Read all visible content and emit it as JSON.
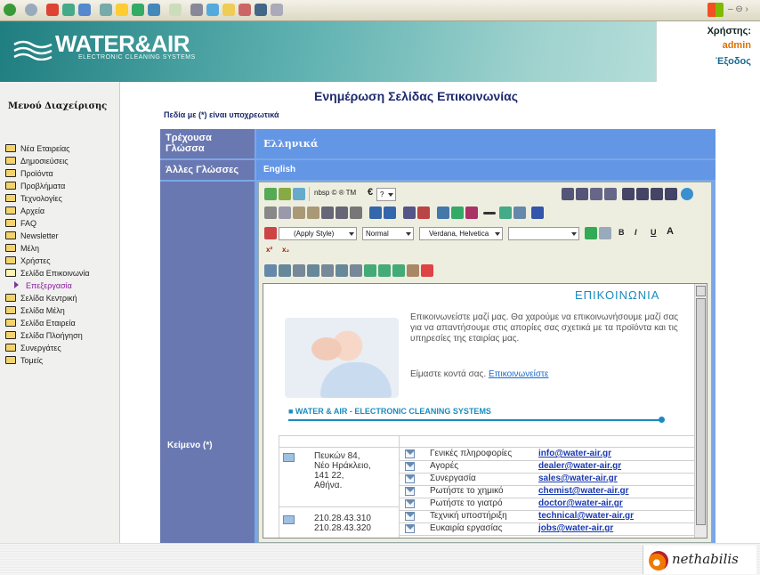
{
  "header": {
    "logo_text": "WATER&AIR",
    "logo_tagline": "ELECTRONIC CLEANING SYSTEMS",
    "user_label": "Χρήστης:",
    "user_name": "admin",
    "logout": "Έξοδος"
  },
  "sidebar": {
    "title": "Μενού Διαχείρισης",
    "items": [
      {
        "label": "Νέα Εταιρείας"
      },
      {
        "label": "Δημοσιεύσεις"
      },
      {
        "label": "Προϊόντα"
      },
      {
        "label": "Προβλήματα"
      },
      {
        "label": "Τεχνολογίες"
      },
      {
        "label": "Αρχεία"
      },
      {
        "label": "FAQ"
      },
      {
        "label": "Newsletter"
      },
      {
        "label": "Μέλη"
      },
      {
        "label": "Χρήστες"
      },
      {
        "label": "Σελίδα Επικοινωνία"
      },
      {
        "label": "Επεξεργασία"
      },
      {
        "label": "Σελίδα Κεντρική"
      },
      {
        "label": "Σελίδα Μέλη"
      },
      {
        "label": "Σελίδα Εταιρεία"
      },
      {
        "label": "Σελίδα Πλοήγηση"
      },
      {
        "label": "Συνεργάτες"
      },
      {
        "label": "Τομείς"
      }
    ]
  },
  "main": {
    "title": "Ενημέρωση Σελίδας Επικοινωνίας",
    "required_note": "Πεδία με (*) είναι υποχρεωτικά",
    "rows": [
      {
        "label": "Τρέχουσα Γλώσσα",
        "value": "Ελληνικά"
      },
      {
        "label": "Άλλες Γλώσσες",
        "value": "English"
      },
      {
        "label": "Κείμενο (*)"
      }
    ]
  },
  "editor": {
    "toolbar": {
      "nbsp_text": "nbsp © ® TM",
      "euro_symbol": "€",
      "question_value": "?",
      "style_select": "(Apply Style)",
      "format_select": "Normal",
      "font_select": "Verdana, Helvetica",
      "size_select": "",
      "bold": "B",
      "italic": "I",
      "underline": "U",
      "font_a": "A",
      "superscript": "x²",
      "subscript": "x₂"
    },
    "content": {
      "heading": "ΕΠΙΚΟΙΝΩΝΙΑ",
      "paragraph": "Επικοινωνείστε μαζί μας. Θα χαρούμε να επικοινωνήσουμε μαζί σας για να απαντήσουμε στις απορίες σας σχετικά με τα προϊόντα και τις υπηρεσίες της εταιρίας μας.",
      "near_text": "Είμαστε κοντά σας.",
      "near_link": "Επικοινωνείστε",
      "company": "■ WATER & AIR - ELECTRONIC CLEANING SYSTEMS",
      "address_lines": [
        "Πευκών 84,",
        "Νέο Ηράκλειο,",
        "141 22,",
        "Αθήνα."
      ],
      "phones": [
        "210.28.43.310",
        "210.28.43.320"
      ],
      "contacts": [
        {
          "label": "Γενικές πληροφορίες",
          "email": "info@water-air.gr"
        },
        {
          "label": "Αγορές",
          "email": "dealer@water-air.gr"
        },
        {
          "label": "Συνεργασία",
          "email": "sales@water-air.gr"
        },
        {
          "label": "Ρωτήστε το χημικό",
          "email": "chemist@water-air.gr"
        },
        {
          "label": "Ρωτήστε το γιατρό",
          "email": "doctor@water-air.gr"
        },
        {
          "label": "Τεχνική υποστήριξη",
          "email": "technical@water-air.gr"
        },
        {
          "label": "Ευκαιρία εργασίας",
          "email": "jobs@water-air.gr"
        }
      ]
    }
  },
  "footer": {
    "brand": "nethabilis"
  },
  "colors": {
    "header_teal": "#1f7e80",
    "label_cell": "#6a78b2",
    "value_cell": "#6496e6",
    "title_blue": "#1b2a6e",
    "accent_orange": "#e07000"
  }
}
